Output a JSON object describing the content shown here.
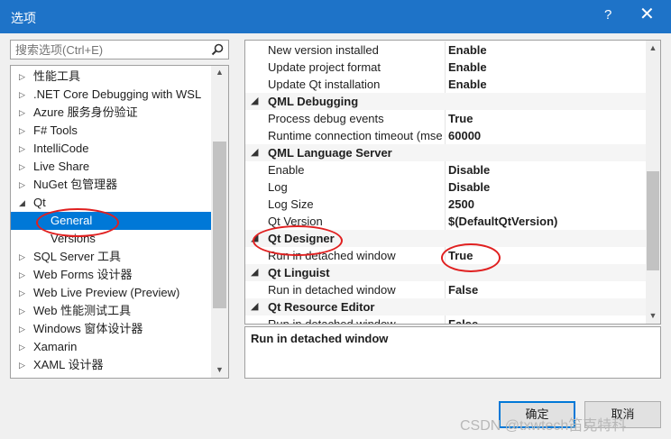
{
  "window": {
    "title": "选项",
    "help_label": "?",
    "close_label": "✕"
  },
  "search": {
    "placeholder": "搜索选项(Ctrl+E)",
    "icon": "search-icon"
  },
  "tree": {
    "items": [
      {
        "label": "性能工具",
        "arrow": "▷"
      },
      {
        "label": ".NET Core Debugging with WSL",
        "arrow": "▷"
      },
      {
        "label": "Azure 服务身份验证",
        "arrow": "▷"
      },
      {
        "label": "F# Tools",
        "arrow": "▷"
      },
      {
        "label": "IntelliCode",
        "arrow": "▷"
      },
      {
        "label": "Live Share",
        "arrow": "▷"
      },
      {
        "label": "NuGet 包管理器",
        "arrow": "▷"
      },
      {
        "label": "Qt",
        "arrow": "◢"
      },
      {
        "label": "General",
        "arrow": ""
      },
      {
        "label": "Versions",
        "arrow": ""
      },
      {
        "label": "SQL Server 工具",
        "arrow": "▷"
      },
      {
        "label": "Web Forms 设计器",
        "arrow": "▷"
      },
      {
        "label": "Web Live Preview (Preview)",
        "arrow": "▷"
      },
      {
        "label": "Web 性能测试工具",
        "arrow": "▷"
      },
      {
        "label": "Windows 窗体设计器",
        "arrow": "▷"
      },
      {
        "label": "Xamarin",
        "arrow": "▷"
      },
      {
        "label": "XAML 设计器",
        "arrow": "▷"
      }
    ],
    "selected": "General"
  },
  "grid": {
    "rows": [
      {
        "type": "prop",
        "name": "New version installed",
        "value": "Enable"
      },
      {
        "type": "prop",
        "name": "Update project format",
        "value": "Enable"
      },
      {
        "type": "prop",
        "name": "Update Qt installation",
        "value": "Enable"
      },
      {
        "type": "cat",
        "name": "QML Debugging",
        "toggle": "◢"
      },
      {
        "type": "prop",
        "name": "Process debug events",
        "value": "True"
      },
      {
        "type": "prop",
        "name": "Runtime connection timeout (mse",
        "value": "60000"
      },
      {
        "type": "cat",
        "name": "QML Language Server",
        "toggle": "◢"
      },
      {
        "type": "prop",
        "name": "Enable",
        "value": "Disable"
      },
      {
        "type": "prop",
        "name": "Log",
        "value": "Disable"
      },
      {
        "type": "prop",
        "name": "Log Size",
        "value": "2500"
      },
      {
        "type": "prop",
        "name": "Qt Version",
        "value": "$(DefaultQtVersion)"
      },
      {
        "type": "cat",
        "name": "Qt Designer",
        "toggle": "◢"
      },
      {
        "type": "prop",
        "name": "Run in detached window",
        "value": "True"
      },
      {
        "type": "cat",
        "name": "Qt Linguist",
        "toggle": "◢"
      },
      {
        "type": "prop",
        "name": "Run in detached window",
        "value": "False"
      },
      {
        "type": "cat",
        "name": "Qt Resource Editor",
        "toggle": "◢"
      },
      {
        "type": "prop",
        "name": "Run in detached window",
        "value": "False"
      }
    ]
  },
  "description": {
    "title": "Run in detached window"
  },
  "buttons": {
    "ok": "确定",
    "cancel": "取消"
  },
  "watermark": "CSDN @txwtech笛克特科",
  "colors": {
    "accent": "#0078d7",
    "titlebar": "#1e73c8",
    "annotation": "#e02020"
  }
}
